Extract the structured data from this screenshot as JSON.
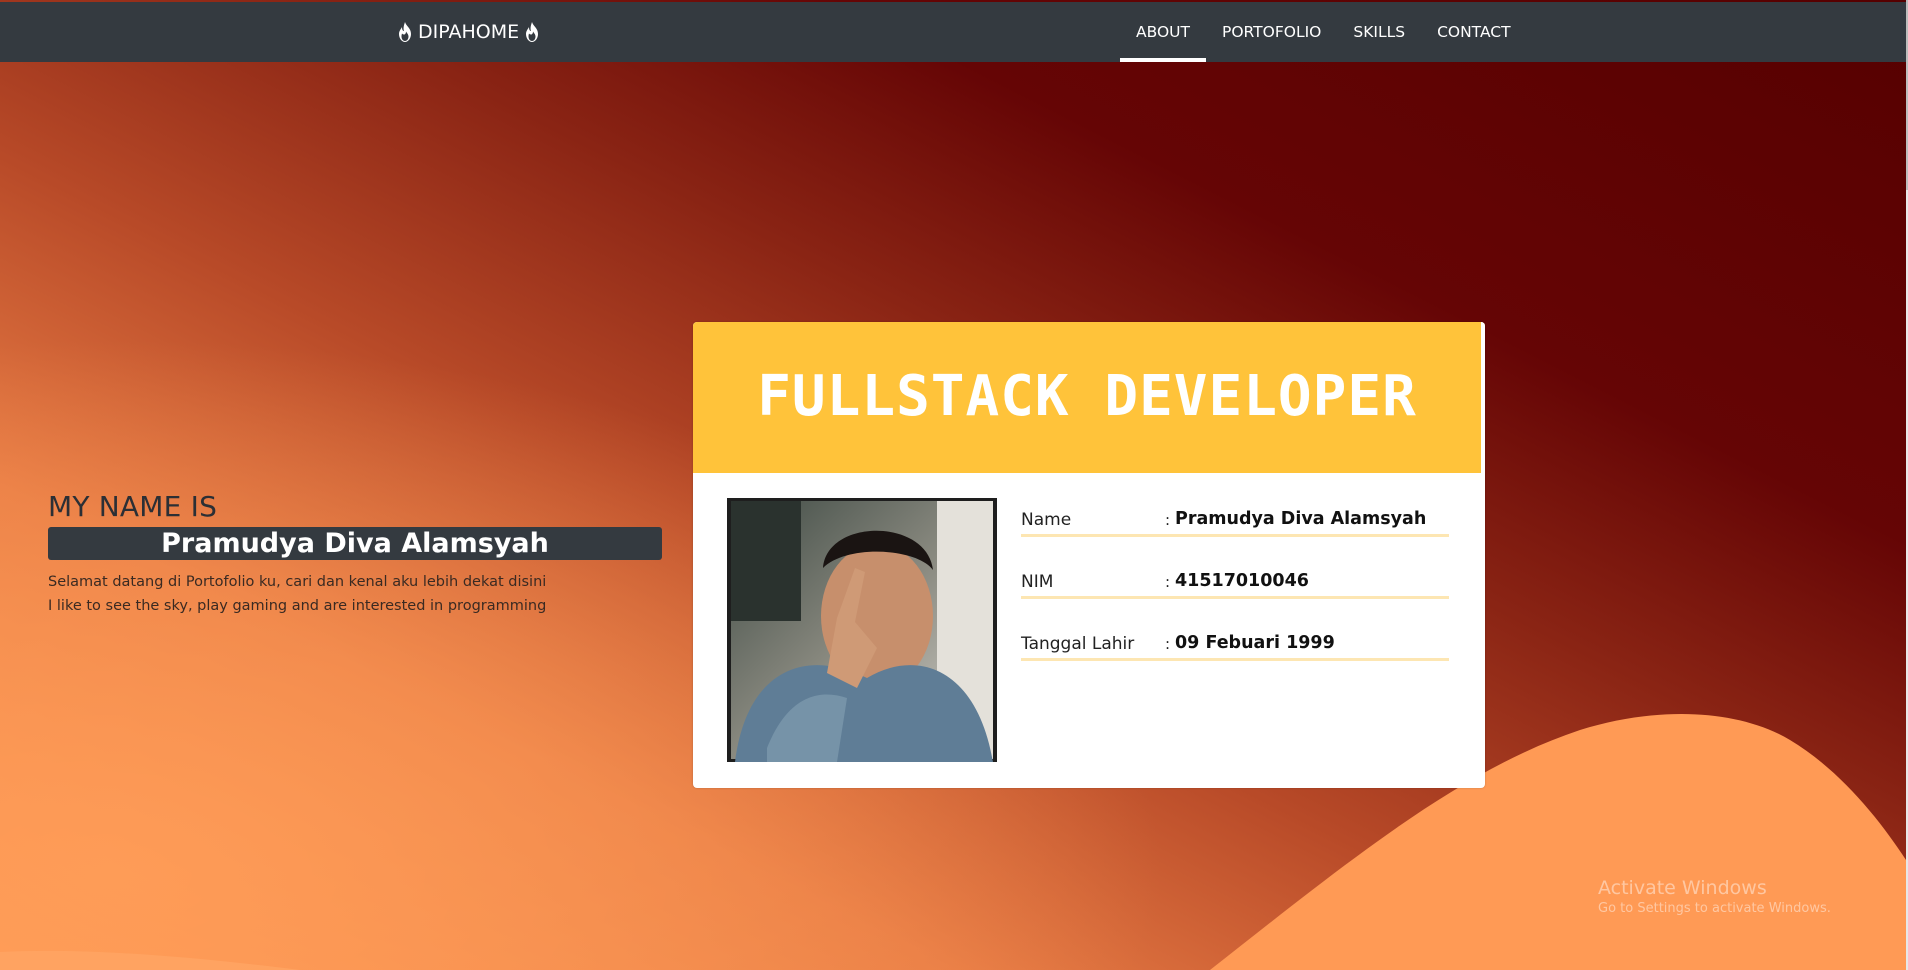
{
  "navbar": {
    "brand": "DIPAHOME",
    "brand_icon": "fire-icon",
    "links": [
      {
        "label": "ABOUT",
        "active": true
      },
      {
        "label": "PORTOFOLIO",
        "active": false
      },
      {
        "label": "SKILLS",
        "active": false
      },
      {
        "label": "CONTACT",
        "active": false
      }
    ]
  },
  "intro": {
    "heading": "MY NAME IS",
    "name": "Pramudya Diva Alamsyah",
    "lines": [
      "Selamat datang di Portofolio ku, cari dan kenal aku lebih dekat disini",
      "I like to see the sky, play gaming and are interested in programming"
    ]
  },
  "card": {
    "title": "FULLSTACK DEVELOPER",
    "rows": [
      {
        "label": "Name",
        "value": "Pramudya Diva Alamsyah"
      },
      {
        "label": "NIM",
        "value": "41517010046"
      },
      {
        "label": "Tanggal Lahir",
        "value": "09 Febuari 1999"
      }
    ]
  },
  "watermark": {
    "title": "Activate Windows",
    "subtitle": "Go to Settings to activate Windows."
  },
  "colors": {
    "navbar": "#343a40",
    "card_header": "#ffc33a",
    "bg_light_orange": "#ff9a55",
    "bg_dark_red": "#560000"
  }
}
